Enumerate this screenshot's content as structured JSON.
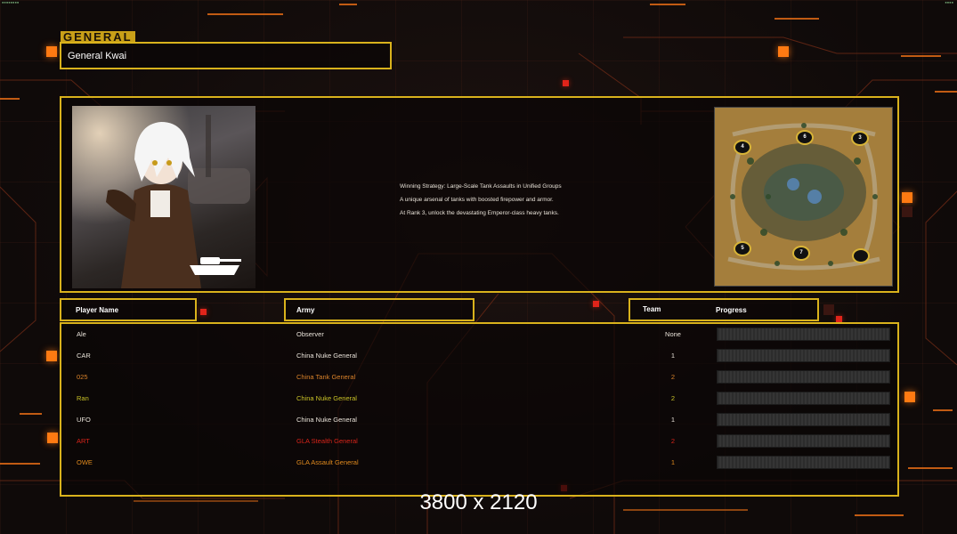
{
  "section_label": "GENERAL",
  "general": {
    "name": "General Kwai",
    "strategy_lines": [
      "Winning Strategy: Large-Scale Tank Assaults in Unified Groups",
      "A unique arsenal of tanks with boosted firepower and armor.",
      "At Rank 3, unlock the devastating Emperor-class heavy tanks."
    ],
    "portrait_icon": "tank-silhouette-icon"
  },
  "minimap": {
    "start_positions": [
      "4",
      "6",
      "3",
      "5",
      "7",
      ""
    ]
  },
  "columns": {
    "player_name": "Player Name",
    "army": "Army",
    "team": "Team",
    "progress": "Progress"
  },
  "players": [
    {
      "name": "Ale",
      "army": "Observer",
      "team": "None",
      "color": "#e8e2d8"
    },
    {
      "name": "CAR",
      "army": "China Nuke General",
      "team": "1",
      "color": "#e8e2d8"
    },
    {
      "name": "025",
      "army": "China Tank General",
      "team": "2",
      "color": "#d9822a"
    },
    {
      "name": "Ran",
      "army": "China Nuke General",
      "team": "2",
      "color": "#c9c227"
    },
    {
      "name": "UFO",
      "army": "China Nuke General",
      "team": "1",
      "color": "#e8e2d8"
    },
    {
      "name": "ART",
      "army": "GLA Stealth General",
      "team": "2",
      "color": "#d8241a"
    },
    {
      "name": "OWE",
      "army": "GLA Assault General",
      "team": "1",
      "color": "#e08a1e"
    }
  ],
  "resolution_label": "3800 x 2120",
  "colors": {
    "frame": "#d9b21c",
    "accent_orange": "#ff7a12",
    "accent_red": "#e0241a"
  }
}
